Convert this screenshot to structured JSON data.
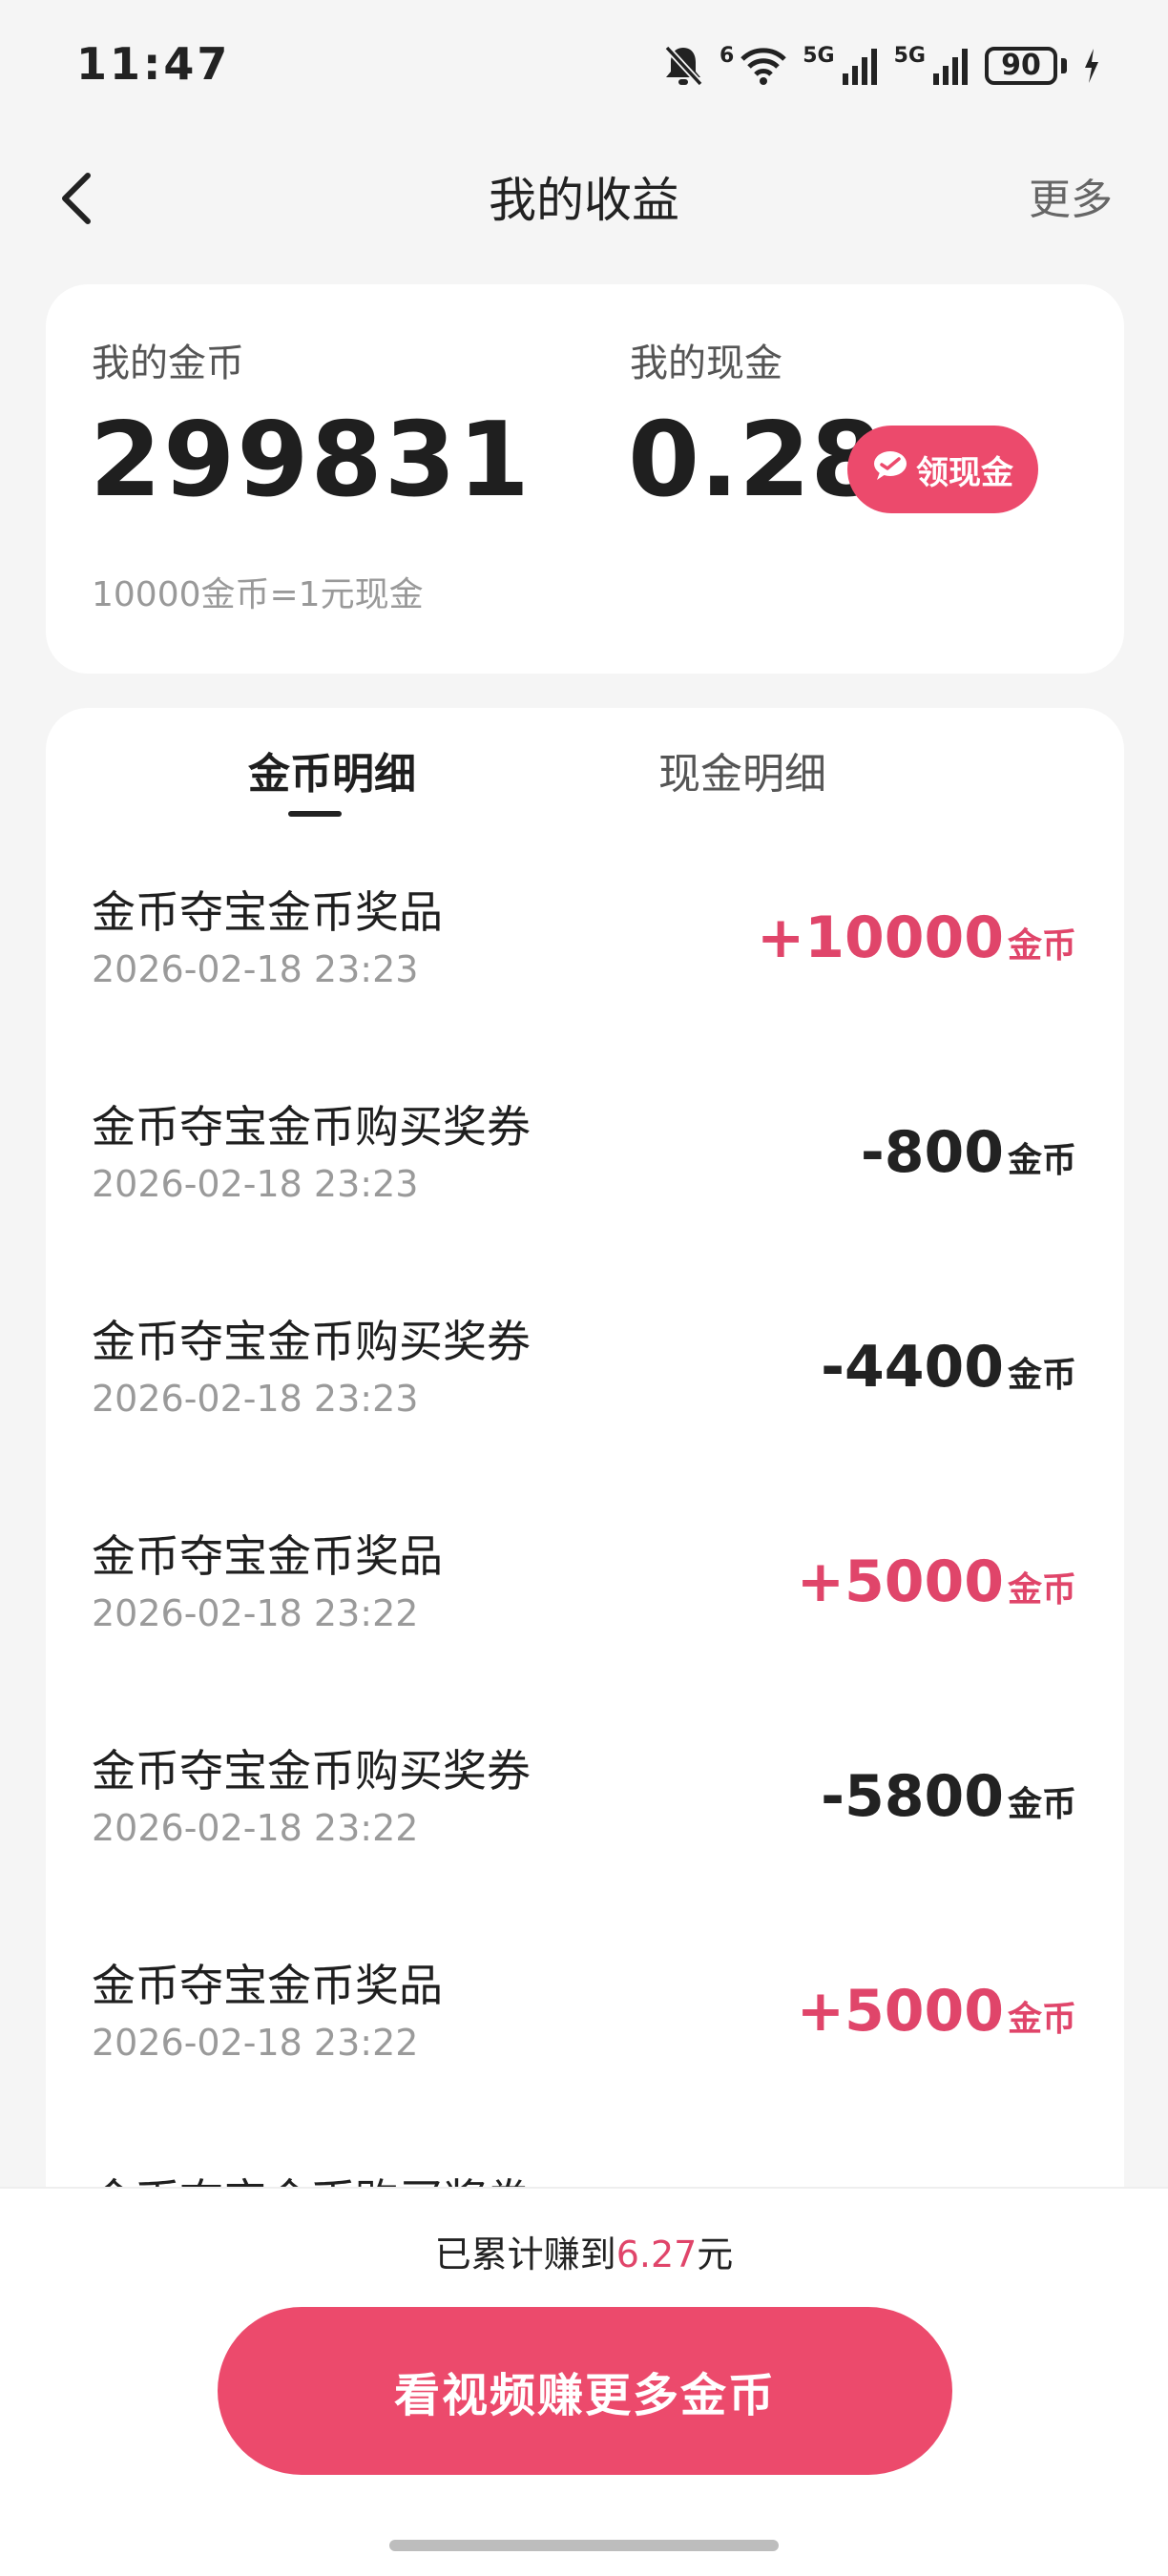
{
  "status_bar": {
    "time": "11:47",
    "battery": "90",
    "net1": "5G",
    "net2": "5G",
    "wifi_label": "6",
    "icons": [
      "bell-off-icon",
      "wifi-icon",
      "signal-icon",
      "signal-icon",
      "battery-icon",
      "charging-icon"
    ]
  },
  "nav": {
    "title": "我的收益",
    "more": "更多",
    "back_icon": "chevron-left-icon"
  },
  "summary": {
    "coin_label": "我的金币",
    "coin_value": "299831",
    "cash_label": "我的现金",
    "cash_value": "0.28",
    "claim_button": "领现金",
    "claim_icon": "wechat-icon",
    "rate_note": "10000金币=1元现金"
  },
  "tabs": [
    {
      "label": "金币明细",
      "active": true
    },
    {
      "label": "现金明细",
      "active": false
    }
  ],
  "transactions": [
    {
      "title": "金币夺宝金币奖品",
      "time": "2026-02-18 23:23",
      "amount": "+10000",
      "unit": "金币"
    },
    {
      "title": "金币夺宝金币购买奖券",
      "time": "2026-02-18 23:23",
      "amount": "-800",
      "unit": "金币"
    },
    {
      "title": "金币夺宝金币购买奖券",
      "time": "2026-02-18 23:23",
      "amount": "-4400",
      "unit": "金币"
    },
    {
      "title": "金币夺宝金币奖品",
      "time": "2026-02-18 23:22",
      "amount": "+5000",
      "unit": "金币"
    },
    {
      "title": "金币夺宝金币购买奖券",
      "time": "2026-02-18 23:22",
      "amount": "-5800",
      "unit": "金币"
    },
    {
      "title": "金币夺宝金币奖品",
      "time": "2026-02-18 23:22",
      "amount": "+5000",
      "unit": "金币"
    },
    {
      "title": "金币夺宝金币购买奖券",
      "time": "",
      "amount": "",
      "unit": ""
    }
  ],
  "bottom": {
    "total_prefix": "已累计赚到",
    "total_amount": "6.27",
    "total_suffix": "元",
    "watch_button": "看视频赚更多金币"
  },
  "colors": {
    "accent": "#ec4a6c",
    "positive": "#e0456a",
    "background": "#f5f5f5"
  }
}
